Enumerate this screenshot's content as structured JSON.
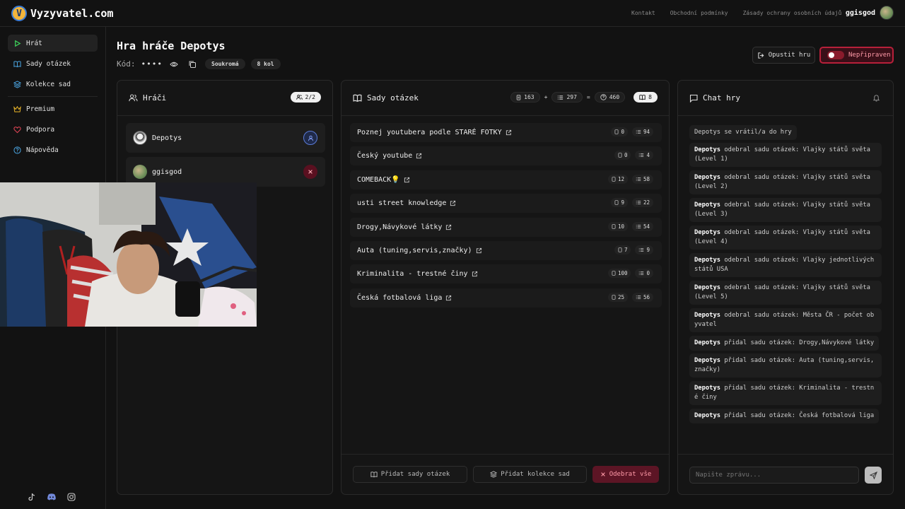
{
  "app": {
    "logo_text": "Vyzyvatel.com"
  },
  "topnav": {
    "links": [
      "Kontakt",
      "Obchodní podmínky",
      "Zásady ochrany osobních údajů"
    ],
    "username": "ggisgod"
  },
  "sidebar": {
    "items": [
      {
        "label": "Hrát",
        "icon": "play-icon",
        "active": true
      },
      {
        "label": "Sady otázek",
        "icon": "book-icon"
      },
      {
        "label": "Kolekce sad",
        "icon": "layers-icon"
      },
      {
        "label": "Premium",
        "icon": "crown-icon"
      },
      {
        "label": "Podpora",
        "icon": "heart-icon"
      },
      {
        "label": "Nápověda",
        "icon": "help-icon"
      }
    ],
    "social": [
      "tiktok-icon",
      "discord-icon",
      "instagram-icon"
    ]
  },
  "game": {
    "title": "Hra hráče Depotys",
    "code_label": "Kód:",
    "code_value": "••••",
    "privacy": "Soukromá",
    "rounds": "8 kol",
    "leave_label": "Opustit hru",
    "ready_label": "Nepřipraven"
  },
  "players": {
    "title": "Hráči",
    "count": "2/2",
    "list": [
      {
        "name": "Depotys"
      },
      {
        "name": "ggisgod"
      }
    ]
  },
  "sets": {
    "title": "Sady otázek",
    "stats": {
      "a": "163",
      "plus": "+",
      "b": "297",
      "eq": "=",
      "total": "460",
      "sets": "8"
    },
    "list": [
      {
        "name": "Poznej youtubera podle STARÉ FOTKY",
        "c1": "0",
        "c2": "94"
      },
      {
        "name": "Český youtube",
        "c1": "0",
        "c2": "4"
      },
      {
        "name": "COMEBACK💡",
        "c1": "12",
        "c2": "58"
      },
      {
        "name": "usti street knowledge",
        "c1": "9",
        "c2": "22"
      },
      {
        "name": "Drogy,Návykové látky",
        "c1": "10",
        "c2": "54"
      },
      {
        "name": "Auta (tuning,servis,značky)",
        "c1": "7",
        "c2": "9"
      },
      {
        "name": "Kriminalita - trestné činy",
        "c1": "100",
        "c2": "0"
      },
      {
        "name": "Česká fotbalová liga",
        "c1": "25",
        "c2": "56"
      }
    ],
    "add_sets": "Přidat sady otázek",
    "add_collections": "Přidat kolekce sad",
    "remove_all": "Odebrat vše"
  },
  "chat": {
    "title": "Chat hry",
    "messages": [
      {
        "user": "",
        "text": "Depotys se vrátil/a do hry"
      },
      {
        "user": "Depotys",
        "text": " odebral sadu otázek: Vlajky států světa (Level 1)"
      },
      {
        "user": "Depotys",
        "text": " odebral sadu otázek: Vlajky států světa (Level 2)"
      },
      {
        "user": "Depotys",
        "text": " odebral sadu otázek: Vlajky států světa (Level 3)"
      },
      {
        "user": "Depotys",
        "text": " odebral sadu otázek: Vlajky států světa (Level 4)"
      },
      {
        "user": "Depotys",
        "text": " odebral sadu otázek: Vlajky jednotlivých států USA"
      },
      {
        "user": "Depotys",
        "text": " odebral sadu otázek: Vlajky států světa (Level 5)"
      },
      {
        "user": "Depotys",
        "text": " odebral sadu otázek: Města ČR - počet obyvatel"
      },
      {
        "user": "Depotys",
        "text": " přidal sadu otázek: Drogy,Návykové látky"
      },
      {
        "user": "Depotys",
        "text": " přidal sadu otázek: Auta (tuning,servis,značky)"
      },
      {
        "user": "Depotys",
        "text": " přidal sadu otázek: Kriminalita - trestné činy"
      },
      {
        "user": "Depotys",
        "text": " přidal sadu otázek: Česká fotbalová liga"
      }
    ],
    "input_placeholder": "Napište zprávu..."
  },
  "colors": {
    "accent_green": "#3ecf5a",
    "danger": "#b8203a",
    "blue": "#5a7bd8"
  }
}
